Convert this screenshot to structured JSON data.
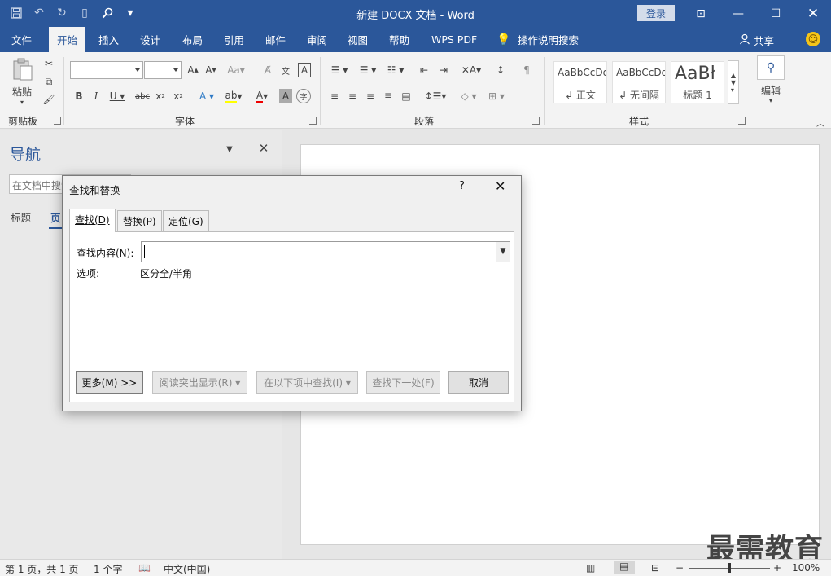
{
  "titlebar": {
    "doc_title": "新建 DOCX 文档  -  Word",
    "login": "登录"
  },
  "tabs": [
    "文件",
    "开始",
    "插入",
    "设计",
    "布局",
    "引用",
    "邮件",
    "审阅",
    "视图",
    "帮助",
    "WPS PDF",
    "操作说明搜索"
  ],
  "share": "共享",
  "ribbon": {
    "paste": "粘贴",
    "clipboard": "剪贴板",
    "font": "字体",
    "paragraph": "段落",
    "styles": "样式",
    "edit": "编辑",
    "style_cards": [
      {
        "sample": "AaBbCcDd",
        "name": "↲ 正文"
      },
      {
        "sample": "AaBbCcDd",
        "name": "↲ 无间隔"
      },
      {
        "sample": "AaBł",
        "name": "标题 1"
      }
    ]
  },
  "nav": {
    "title": "导航",
    "search_placeholder": "在文档中搜索",
    "tab_headings": "标题",
    "tab_pages": "页"
  },
  "dialog": {
    "title": "查找和替换",
    "help": "?",
    "tabs": [
      "查找(D)",
      "替换(P)",
      "定位(G)"
    ],
    "find_label": "查找内容(N):",
    "find_value": "",
    "options_label": "选项:",
    "options_value": "区分全/半角",
    "buttons": {
      "more": "更多(M) >>",
      "reading_highlight": "阅读突出显示(R) ▾",
      "find_in": "在以下项中查找(I) ▾",
      "find_next": "查找下一处(F)",
      "cancel": "取消"
    }
  },
  "status": {
    "page": "第 1 页，共 1 页",
    "words": "1 个字",
    "language": "中文(中国)",
    "zoom": "100%"
  },
  "watermark": "最需教育",
  "colors": {
    "accent": "#2b579a"
  }
}
